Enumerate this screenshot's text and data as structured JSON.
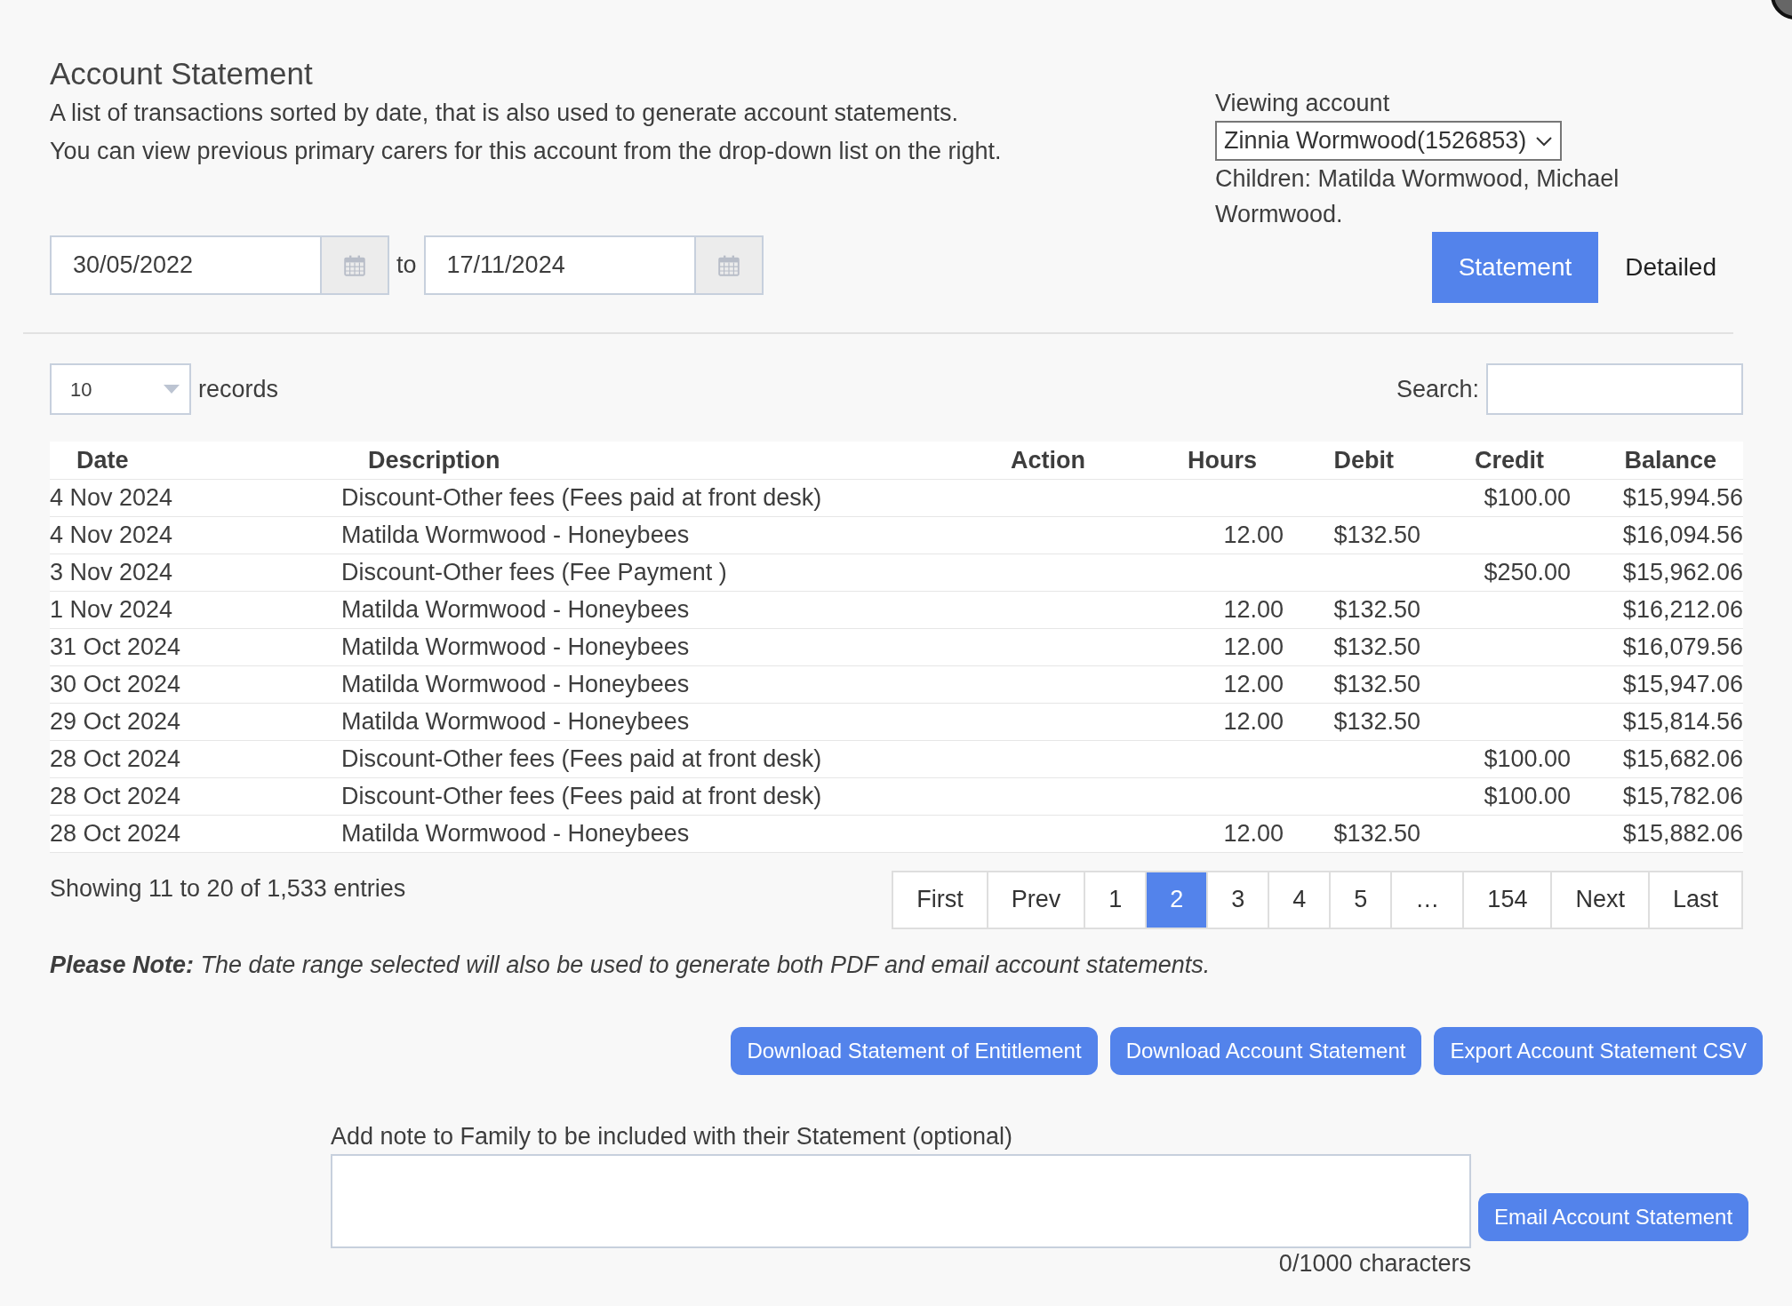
{
  "header": {
    "title": "Account Statement",
    "description": [
      "A list of transactions sorted by date, that is also used to generate account statements.",
      "You can view previous primary carers for this account from the drop-down list on the right."
    ]
  },
  "date_range": {
    "from": "30/05/2022",
    "separator": "to",
    "to": "17/11/2024"
  },
  "account": {
    "label": "Viewing account",
    "selected_account": "Zinnia Wormwood(1526853)",
    "children_text": "Children: Matilda Wormwood, Michael Wormwood."
  },
  "view_tabs": [
    {
      "label": "Statement",
      "selected": true
    },
    {
      "label": "Detailed",
      "selected": false
    }
  ],
  "length_menu": {
    "value": "10",
    "label": "records"
  },
  "search": {
    "label": "Search:"
  },
  "table": {
    "columns": [
      "Date",
      "Description",
      "Action",
      "Hours",
      "Debit",
      "Credit",
      "Balance"
    ],
    "rows": [
      {
        "date": "4 Nov 2024",
        "description": "Discount-Other fees (Fees paid at front desk)",
        "credit": "$100.00",
        "balance": "$15,994.56"
      },
      {
        "date": "4 Nov 2024",
        "description": "Matilda Wormwood - Honeybees",
        "hours": "12.00",
        "debit": "$132.50",
        "balance": "$16,094.56"
      },
      {
        "date": "3 Nov 2024",
        "description": "Discount-Other fees (Fee Payment )",
        "credit": "$250.00",
        "balance": "$15,962.06"
      },
      {
        "date": "1 Nov 2024",
        "description": "Matilda Wormwood - Honeybees",
        "hours": "12.00",
        "debit": "$132.50",
        "balance": "$16,212.06"
      },
      {
        "date": "31 Oct 2024",
        "description": "Matilda Wormwood - Honeybees",
        "hours": "12.00",
        "debit": "$132.50",
        "balance": "$16,079.56"
      },
      {
        "date": "30 Oct 2024",
        "description": "Matilda Wormwood - Honeybees",
        "hours": "12.00",
        "debit": "$132.50",
        "balance": "$15,947.06"
      },
      {
        "date": "29 Oct 2024",
        "description": "Matilda Wormwood - Honeybees",
        "hours": "12.00",
        "debit": "$132.50",
        "balance": "$15,814.56"
      },
      {
        "date": "28 Oct 2024",
        "description": "Discount-Other fees (Fees paid at front desk)",
        "credit": "$100.00",
        "balance": "$15,682.06"
      },
      {
        "date": "28 Oct 2024",
        "description": "Discount-Other fees (Fees paid at front desk)",
        "credit": "$100.00",
        "balance": "$15,782.06"
      },
      {
        "date": "28 Oct 2024",
        "description": "Matilda Wormwood - Honeybees",
        "hours": "12.00",
        "debit": "$132.50",
        "balance": "$15,882.06"
      }
    ]
  },
  "info": "Showing 11 to 20 of 1,533 entries",
  "pagination": [
    {
      "label": "First",
      "selected": false
    },
    {
      "label": "Prev",
      "selected": false
    },
    {
      "label": "1",
      "selected": false
    },
    {
      "label": "2",
      "selected": true
    },
    {
      "label": "3",
      "selected": false
    },
    {
      "label": "4",
      "selected": false
    },
    {
      "label": "5",
      "selected": false
    },
    {
      "label": "…",
      "selected": false
    },
    {
      "label": "154",
      "selected": false
    },
    {
      "label": "Next",
      "selected": false
    },
    {
      "label": "Last",
      "selected": false
    }
  ],
  "note": "**Please Note:** The date range selected will also be used to generate both PDF and email account statements.",
  "actions": [
    "Download Statement of Entitlement",
    "Download Account Statement",
    "Export Account Statement CSV"
  ],
  "family_note": {
    "label": "Add note to Family to be included with their Statement (optional)",
    "counter": "0/1000 characters",
    "button": "Email Account Statement"
  }
}
